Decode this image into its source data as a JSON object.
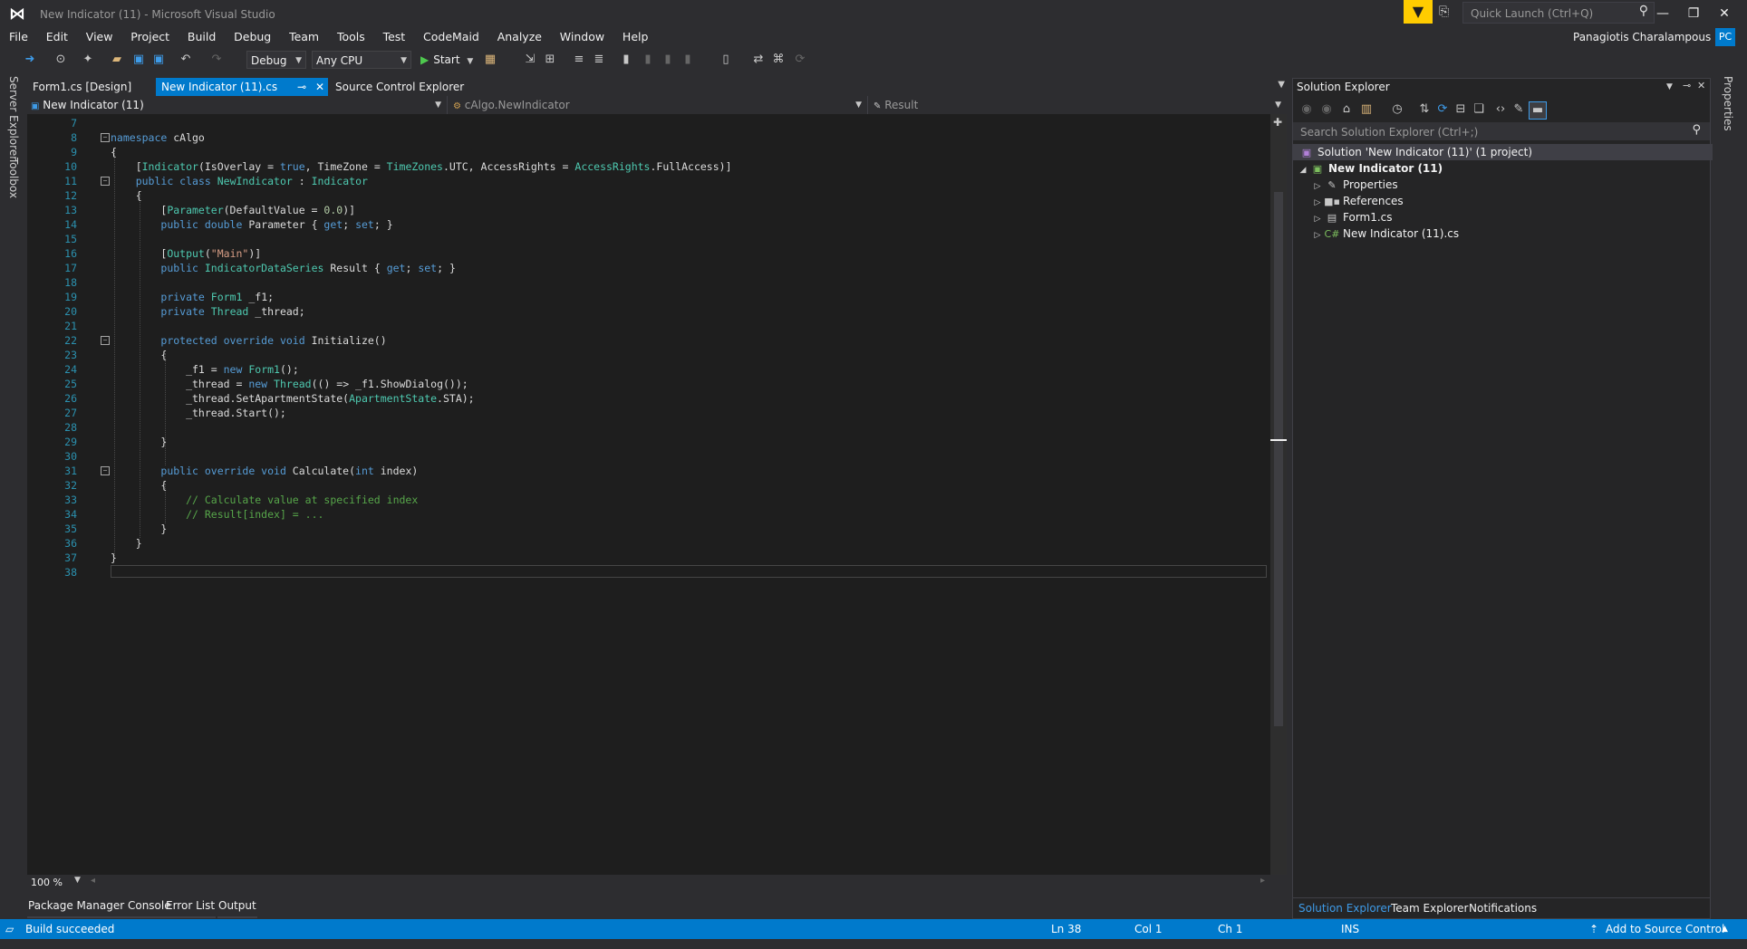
{
  "window": {
    "title": "New Indicator (11) - Microsoft Visual Studio",
    "quick_launch_placeholder": "Quick Launch (Ctrl+Q)",
    "user_name": "Panagiotis Charalampous",
    "user_initials": "PC"
  },
  "menu": [
    "File",
    "Edit",
    "View",
    "Project",
    "Build",
    "Debug",
    "Team",
    "Tools",
    "Test",
    "CodeMaid",
    "Analyze",
    "Window",
    "Help"
  ],
  "toolbar": {
    "configuration": "Debug",
    "platform": "Any CPU",
    "start_label": "Start"
  },
  "left_strip": [
    "Server Explorer",
    "Toolbox"
  ],
  "right_strip": [
    "Properties"
  ],
  "doc_tabs": [
    {
      "label": "Form1.cs [Design]",
      "active": false
    },
    {
      "label": "New Indicator (11).cs",
      "active": true
    },
    {
      "label": "Source Control Explorer",
      "active": false
    }
  ],
  "navbar": {
    "project": "New Indicator (11)",
    "type": "cAlgo.NewIndicator",
    "member": "Result"
  },
  "editor": {
    "zoom": "100 %",
    "lines": [
      "7",
      "8",
      "9",
      "10",
      "11",
      "12",
      "13",
      "14",
      "15",
      "16",
      "17",
      "18",
      "19",
      "20",
      "21",
      "22",
      "23",
      "24",
      "25",
      "26",
      "27",
      "28",
      "29",
      "30",
      "31",
      "32",
      "33",
      "34",
      "35",
      "36",
      "37",
      "38"
    ]
  },
  "bottom_tabs": [
    "Package Manager Console",
    "Error List",
    "Output"
  ],
  "solution_explorer": {
    "title": "Solution Explorer",
    "search_placeholder": "Search Solution Explorer (Ctrl+;)",
    "solution": "Solution 'New Indicator (11)' (1 project)",
    "project": "New Indicator (11)",
    "items": [
      "Properties",
      "References",
      "Form1.cs",
      "New Indicator (11).cs"
    ],
    "tabs": [
      "Solution Explorer",
      "Team Explorer",
      "Notifications"
    ]
  },
  "status": {
    "message": "Build succeeded",
    "line": "Ln 38",
    "col": "Col 1",
    "ch": "Ch 1",
    "mode": "INS",
    "source_control": "Add to Source Control"
  },
  "colors": {
    "accent": "#007acc",
    "keyword": "#569cd6",
    "type": "#4ec9b0",
    "string": "#d69d85",
    "comment": "#57a64a",
    "line_number": "#2b91af"
  }
}
